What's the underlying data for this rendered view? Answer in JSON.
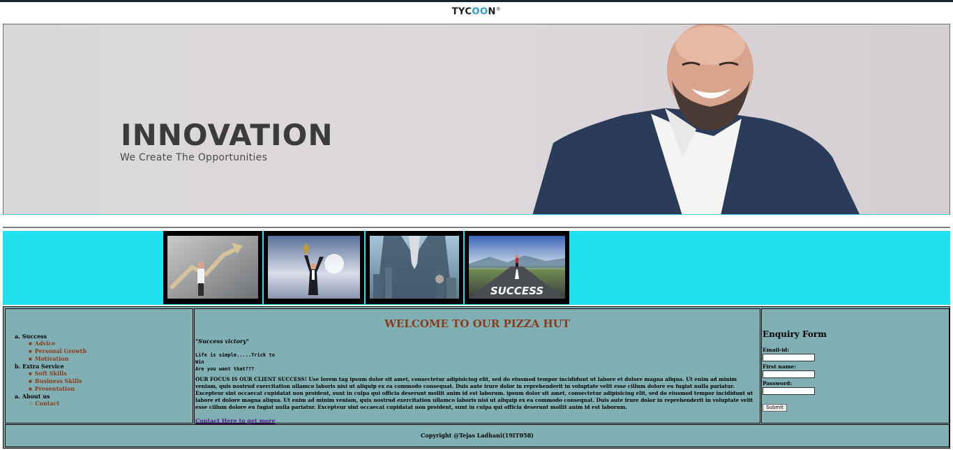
{
  "header": {
    "logo_prefix": "TYC",
    "logo_accent": "OO",
    "logo_suffix": "N",
    "logo_mark": "®"
  },
  "hero": {
    "title": "INNOVATION",
    "subtitle": "We Create The Opportunities"
  },
  "gallery": {
    "images": [
      "businessman-growth-chart",
      "businessman-trophy",
      "businessman-city-skyline",
      "success-road-runner"
    ],
    "road_text": "SUCCESS"
  },
  "sidebar": {
    "sections": [
      {
        "label": "a. Success",
        "items": [
          "Advice",
          "Personal Growth",
          "Motivation"
        ]
      },
      {
        "label": "b. Extra Service",
        "items": [
          "Soft Skills",
          "Business Skills",
          "Presentation"
        ]
      },
      {
        "label": "a. About us",
        "items": [
          "Contact"
        ]
      }
    ]
  },
  "content": {
    "heading": "WELCOME TO OUR PIZZA HUT",
    "quote": "\"Success victory\"",
    "pre_text": "Life is simple.....Trick to\nWin\nAre you want that???",
    "paragraph": "OUR FOCUS IS OUR CLIENT SUCCESS! Use lorem tag ipsum dolor sit amet, consectetur adipisicing elit, sed do eiusmod tempor incididunt ut labore et dolore magna aliqua. Ut enim ad minim veniam, quis nostrud exercitation ullamco laboris nisi ut aliquip ex ea commodo consequat. Duis aute irure dolor in reprehenderit in voluptate velit esse cillum dolore eu fugiat nulla pariatur. Excepteur sint occaecat cupidatat non proident, sunt in culpa qui officia deserunt mollit anim id est laborum. ipsum dolor sit amet, consectetur adipisicing elit, sed do eiusmod tempor incididunt ut labore et dolore magna aliqua. Ut enim ad minim veniam, quis nostrud exercitation ullamco laboris nisi ut aliquip ex ea commodo consequat. Duis aute irure dolor in reprehenderit in voluptate velit esse cillum dolore eu fugiat nulla pariatur. Excepteur sint occaecat cupidatat non proident, sunt in culpa qui officia deserunt mollit anim id est laborum.",
    "link": "Contact Here to get more"
  },
  "form": {
    "title": "Enquiry Form",
    "email_label": "Email-id:",
    "email_value": "",
    "first_name_label": "First name:",
    "first_name_value": "",
    "password_label": "Password:",
    "password_value": "",
    "submit_label": "Submit"
  },
  "footer": {
    "copyright": "Copyright @Tejas Ladhani(19IT058)"
  },
  "colors": {
    "gallery_bg": "#20e1f0",
    "main_bg": "#80b0b4",
    "accent_brown": "#8b3a1a",
    "logo_blue": "#2a9ad6"
  }
}
